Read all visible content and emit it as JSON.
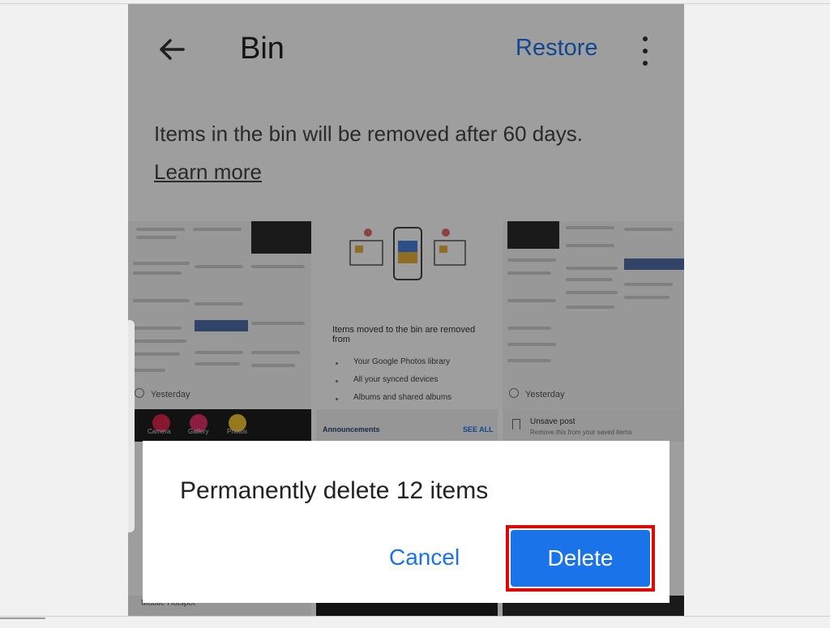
{
  "appbar": {
    "title": "Bin",
    "back_icon": "arrow-back-icon",
    "restore_label": "Restore",
    "more_icon": "more-vert-icon"
  },
  "info": {
    "text": "Items in the bin will be removed after 60 days.",
    "learn_more": "Learn more"
  },
  "thumbnails": [
    {
      "date": "Yesterday"
    },
    {
      "title": "Items moved to the bin are removed from",
      "items": [
        "Your Google Photos library",
        "All your synced devices",
        "Albums and shared albums"
      ]
    },
    {
      "date": "Yesterday"
    }
  ],
  "strips": {
    "apps": [
      "Camera",
      "Gallery",
      "Photos"
    ],
    "announcements": "Announcements",
    "see_all": "SEE ALL",
    "unsave_title": "Unsave post",
    "unsave_sub": "Remove this from your saved items",
    "mobile": "Mobile Hotspot"
  },
  "dialog": {
    "message": "Permanently delete 12 items",
    "cancel": "Cancel",
    "delete": "Delete",
    "highlight_color": "#e10600",
    "accent": "#1a73e8"
  }
}
